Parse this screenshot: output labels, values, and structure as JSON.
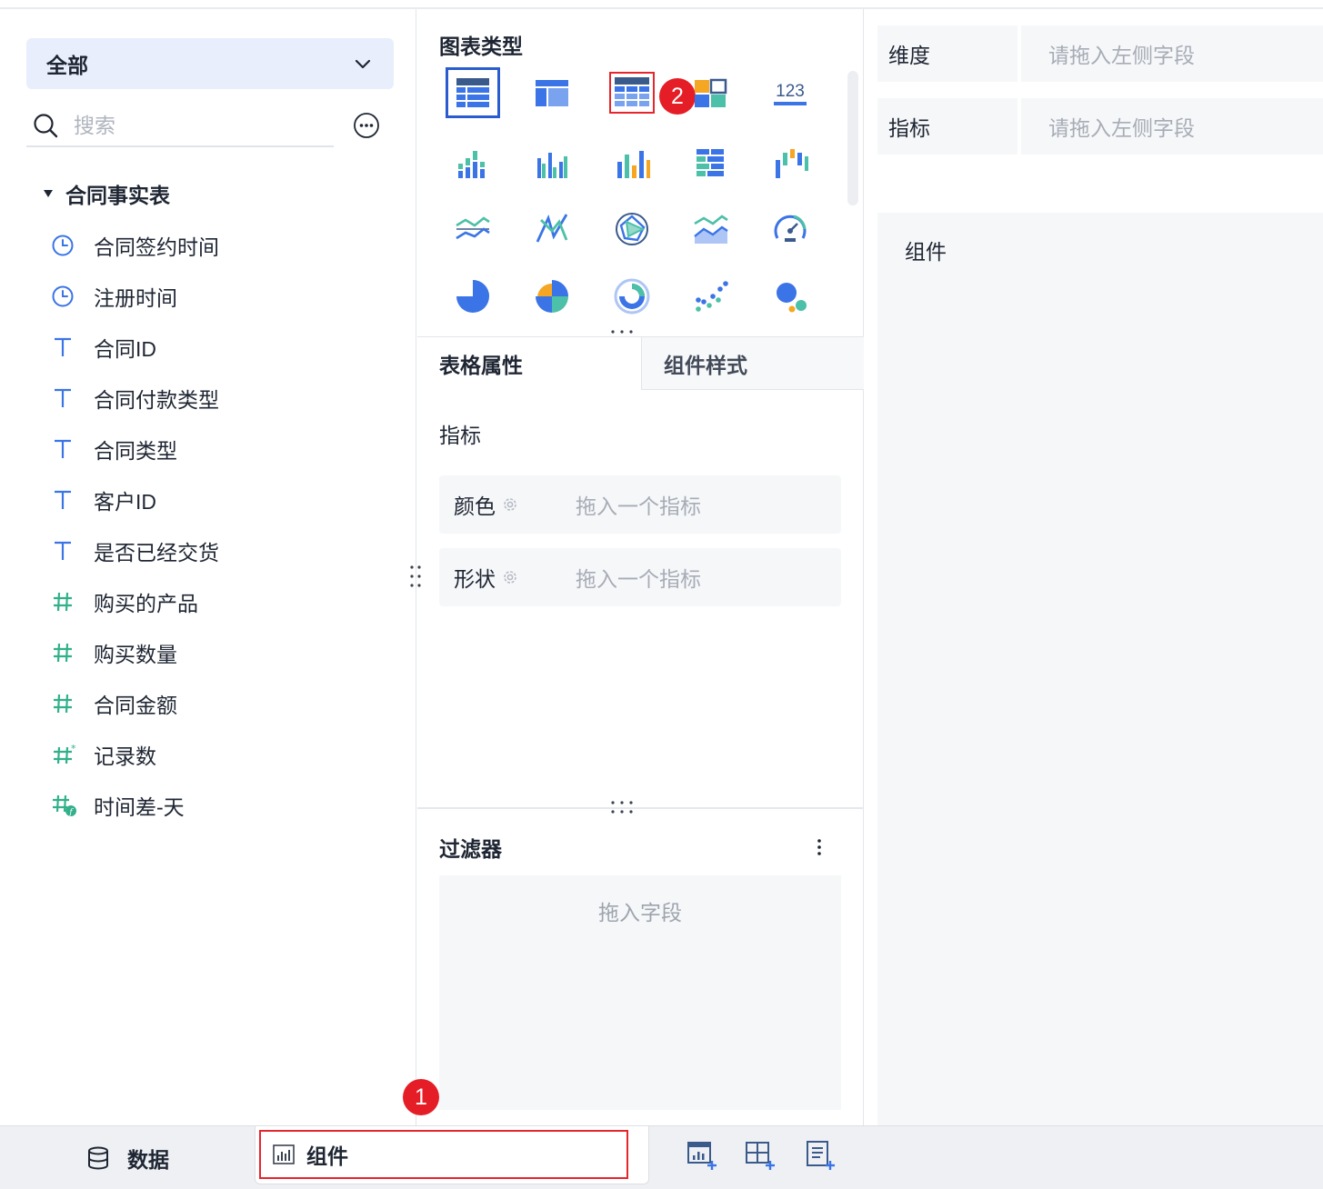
{
  "left": {
    "scope": "全部",
    "search_placeholder": "搜索",
    "table_name": "合同事实表",
    "fields": [
      {
        "label": "合同签约时间",
        "icon": "clock-icon"
      },
      {
        "label": "注册时间",
        "icon": "clock-icon"
      },
      {
        "label": "合同ID",
        "icon": "text-type-icon"
      },
      {
        "label": "合同付款类型",
        "icon": "text-type-icon"
      },
      {
        "label": "合同类型",
        "icon": "text-type-icon"
      },
      {
        "label": "客户ID",
        "icon": "text-type-icon"
      },
      {
        "label": "是否已经交货",
        "icon": "text-type-icon"
      },
      {
        "label": "购买的产品",
        "icon": "number-type-icon"
      },
      {
        "label": "购买数量",
        "icon": "number-type-icon"
      },
      {
        "label": "合同金额",
        "icon": "number-type-icon"
      },
      {
        "label": "记录数",
        "icon": "record-count-icon"
      },
      {
        "label": "时间差-天",
        "icon": "calculated-field-icon"
      }
    ]
  },
  "middle": {
    "chart_type_title": "图表类型",
    "badge_2": "2",
    "badge_3": "123",
    "tabs": {
      "active": "表格属性",
      "inactive": "组件样式"
    },
    "metric_label": "指标",
    "color_row": {
      "label": "颜色",
      "placeholder": "拖入一个指标"
    },
    "shape_row": {
      "label": "形状",
      "placeholder": "拖入一个指标"
    },
    "filter_title": "过滤器",
    "filter_placeholder": "拖入字段"
  },
  "right": {
    "dimension": {
      "label": "维度",
      "placeholder": "请拖入左侧字段"
    },
    "metric": {
      "label": "指标",
      "placeholder": "请拖入左侧字段"
    },
    "canvas_title": "组件"
  },
  "bottom": {
    "data_tab": "数据",
    "component_tab": "组件",
    "badge_1": "1"
  },
  "colors": {
    "accent": "#2a5ccf",
    "highlight_red": "#e5262c",
    "teal": "#31b08a",
    "blue": "#3a74e6",
    "orange": "#f5a623"
  }
}
